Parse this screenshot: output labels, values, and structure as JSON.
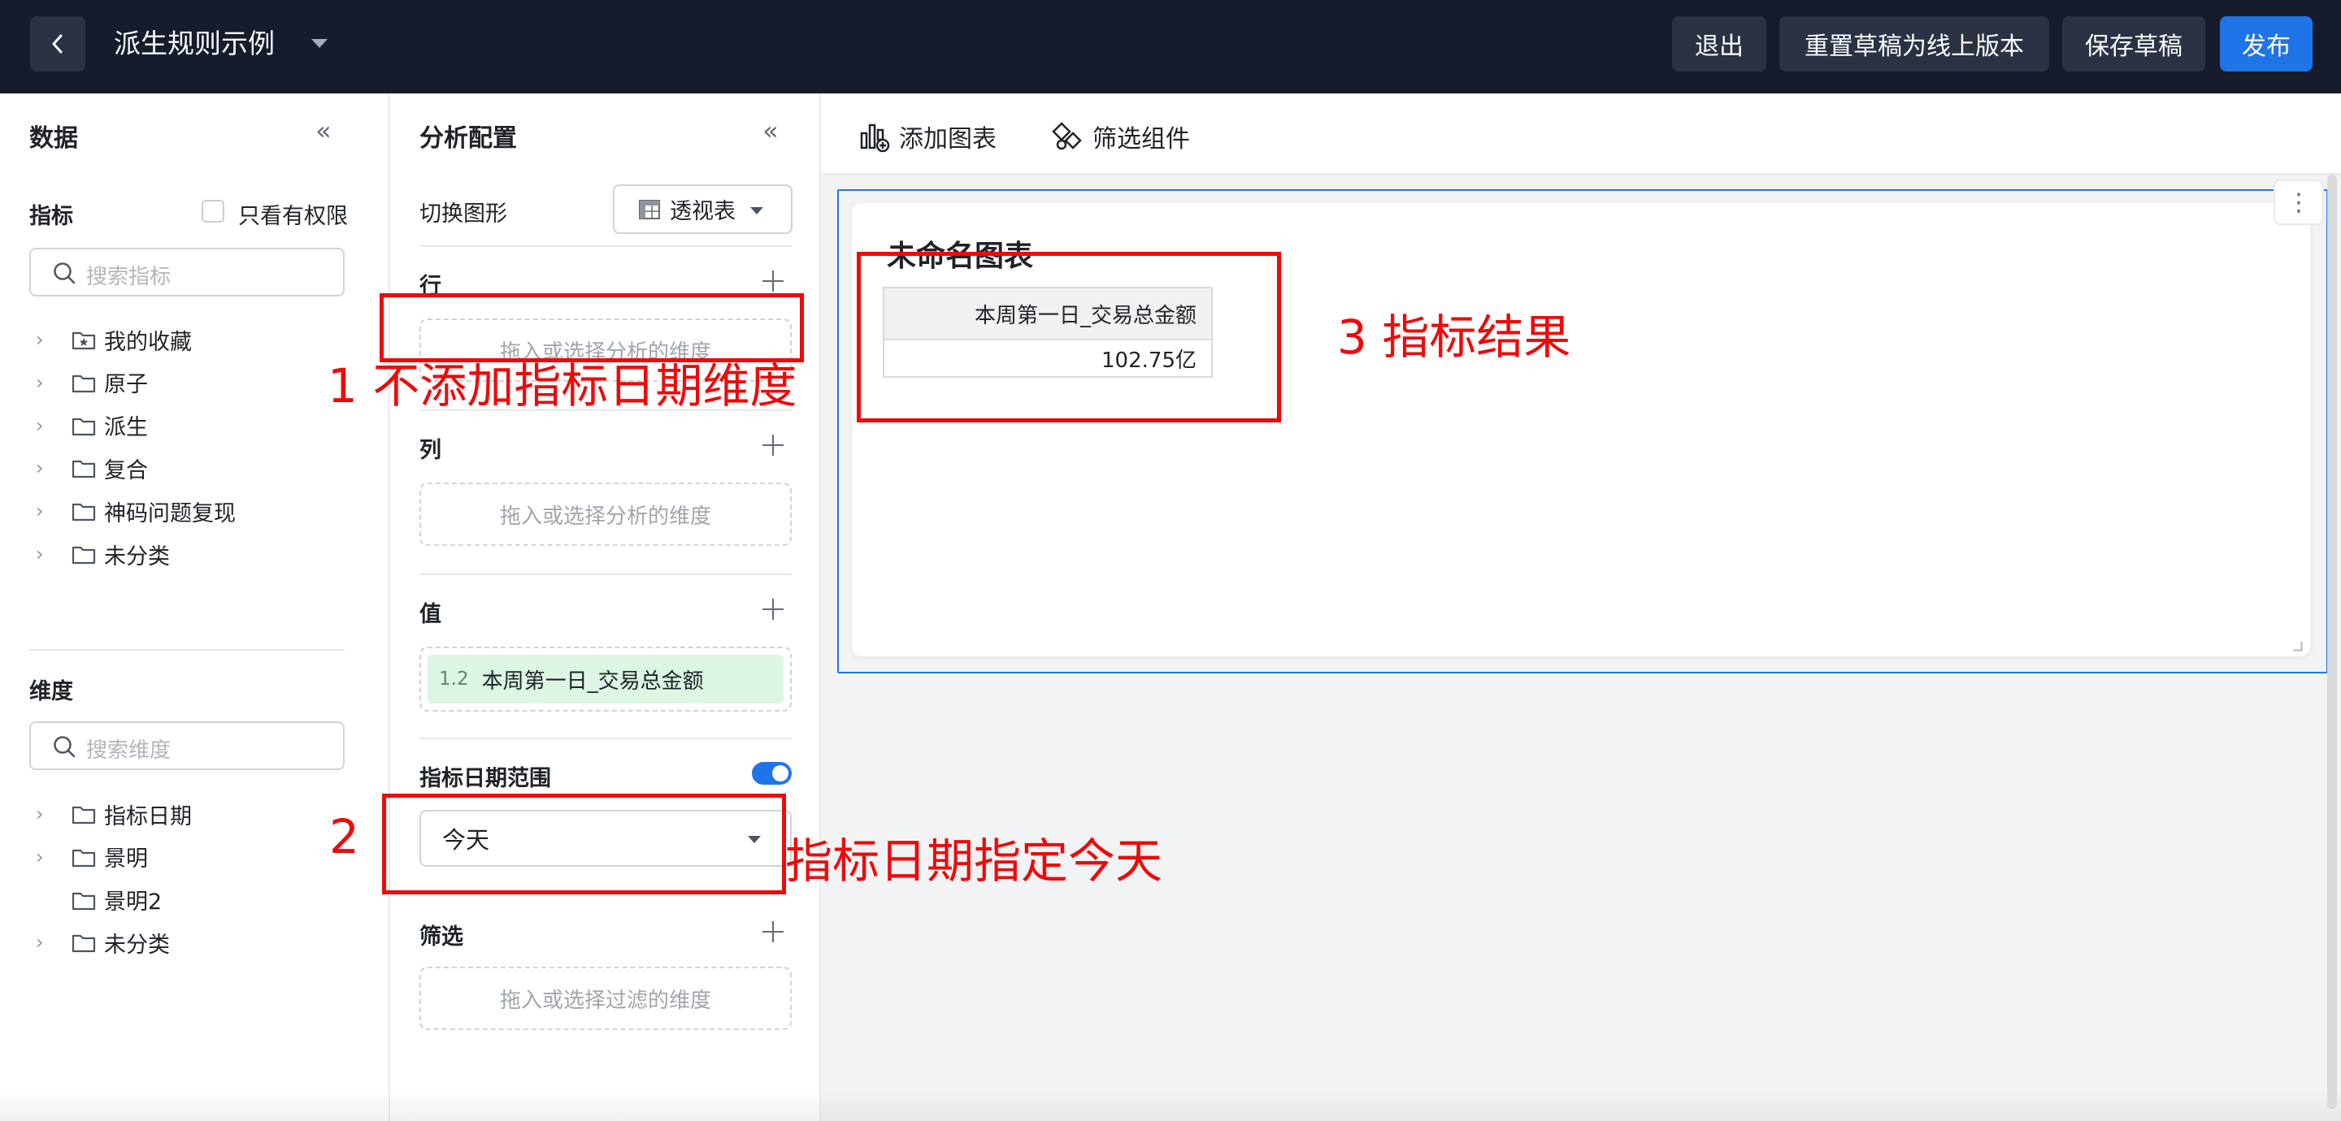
{
  "header": {
    "title": "派生规则示例",
    "buttons": {
      "exit": "退出",
      "reset": "重置草稿为线上版本",
      "save": "保存草稿",
      "publish": "发布"
    }
  },
  "data_panel": {
    "title": "数据",
    "metrics": {
      "label": "指标",
      "only_permitted": "只看有权限",
      "search_placeholder": "搜索指标",
      "tree": [
        {
          "label": "我的收藏",
          "icon": "star-folder-icon",
          "expandable": true
        },
        {
          "label": "原子",
          "icon": "folder-icon",
          "expandable": true
        },
        {
          "label": "派生",
          "icon": "folder-icon",
          "expandable": true
        },
        {
          "label": "复合",
          "icon": "folder-icon",
          "expandable": true
        },
        {
          "label": "神码问题复现",
          "icon": "folder-icon",
          "expandable": true
        },
        {
          "label": "未分类",
          "icon": "folder-icon",
          "expandable": true
        }
      ]
    },
    "dimensions": {
      "label": "维度",
      "search_placeholder": "搜索维度",
      "tree": [
        {
          "label": "指标日期",
          "icon": "folder-icon",
          "expandable": true
        },
        {
          "label": "景明",
          "icon": "folder-icon",
          "expandable": true
        },
        {
          "label": "景明2",
          "icon": "folder-icon",
          "expandable": false
        },
        {
          "label": "未分类",
          "icon": "folder-icon",
          "expandable": true
        }
      ]
    }
  },
  "config_panel": {
    "title": "分析配置",
    "switch_chart_label": "切换图形",
    "chart_type": "透视表",
    "rows": {
      "label": "行",
      "placeholder": "拖入或选择分析的维度"
    },
    "columns": {
      "label": "列",
      "placeholder": "拖入或选择分析的维度"
    },
    "values": {
      "label": "值",
      "chip_index": "1.2",
      "chip_label": "本周第一日_交易总金额"
    },
    "date_range": {
      "label": "指标日期范围",
      "enabled": true,
      "selected": "今天"
    },
    "filters": {
      "label": "筛选",
      "placeholder": "拖入或选择过滤的维度"
    }
  },
  "canvas": {
    "toolbar": {
      "add_chart": "添加图表",
      "filter_component": "筛选组件"
    },
    "chart": {
      "title": "未命名图表",
      "more": "⋮",
      "table": {
        "header": "本周第一日_交易总金额",
        "value": "102.75亿"
      }
    }
  },
  "annotations": {
    "a1": "1 不添加指标日期维度",
    "a2_num": "2",
    "a2_text": "指标日期指定今天",
    "a3": "3 指标结果"
  },
  "colors": {
    "topbar": "#161c2c",
    "primary": "#1f75e8",
    "annotation": "#ee0a0a",
    "value_chip": "#dcf6e3"
  }
}
